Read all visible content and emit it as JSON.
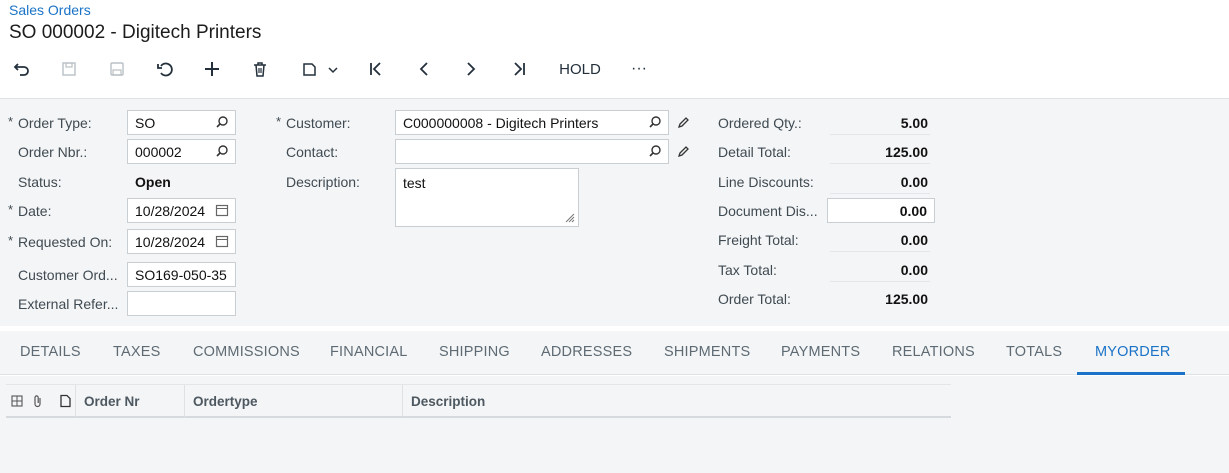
{
  "breadcrumb": "Sales Orders",
  "title": "SO 000002 - Digitech Printers",
  "toolbar": {
    "buttons": [
      {
        "name": "back-icon"
      },
      {
        "name": "save-close-icon",
        "disabled": true
      },
      {
        "name": "save-icon",
        "disabled": true
      },
      {
        "name": "undo-icon"
      },
      {
        "name": "add-icon"
      },
      {
        "name": "delete-icon"
      },
      {
        "name": "copy-paste-icon"
      },
      {
        "name": "first-record-icon"
      },
      {
        "name": "previous-record-icon"
      },
      {
        "name": "next-record-icon"
      },
      {
        "name": "last-record-icon"
      }
    ],
    "hold_label": "HOLD",
    "more_label": "···"
  },
  "form": {
    "order_type": {
      "label": "Order Type:",
      "value": "SO"
    },
    "order_nbr": {
      "label": "Order Nbr.:",
      "value": "000002"
    },
    "status": {
      "label": "Status:",
      "value": "Open"
    },
    "date": {
      "label": "Date:",
      "value": "10/28/2024"
    },
    "requested_on": {
      "label": "Requested On:",
      "value": "10/28/2024"
    },
    "customer_ord": {
      "label": "Customer Ord...",
      "value": "SO169-050-35"
    },
    "external_ref": {
      "label": "External Refer...",
      "value": ""
    },
    "customer": {
      "label": "Customer:",
      "value": "C000000008 - Digitech Printers"
    },
    "contact": {
      "label": "Contact:",
      "value": ""
    },
    "description": {
      "label": "Description:",
      "value": "test"
    }
  },
  "totals": {
    "ordered_qty": {
      "label": "Ordered Qty.:",
      "value": "5.00"
    },
    "detail_total": {
      "label": "Detail Total:",
      "value": "125.00"
    },
    "line_discounts": {
      "label": "Line Discounts:",
      "value": "0.00"
    },
    "document_dis": {
      "label": "Document Dis...",
      "value": "0.00"
    },
    "freight_total": {
      "label": "Freight Total:",
      "value": "0.00"
    },
    "tax_total": {
      "label": "Tax Total:",
      "value": "0.00"
    },
    "order_total": {
      "label": "Order Total:",
      "value": "125.00"
    }
  },
  "tabs": [
    "DETAILS",
    "TAXES",
    "COMMISSIONS",
    "FINANCIAL",
    "SHIPPING",
    "ADDRESSES",
    "SHIPMENTS",
    "PAYMENTS",
    "RELATIONS",
    "TOTALS",
    "MYORDER"
  ],
  "active_tab": "MYORDER",
  "grid": {
    "columns": [
      "Order Nr",
      "Ordertype",
      "Description"
    ],
    "rows": []
  },
  "colors": {
    "accent": "#1a73c7",
    "background": "#f4f5f6"
  }
}
